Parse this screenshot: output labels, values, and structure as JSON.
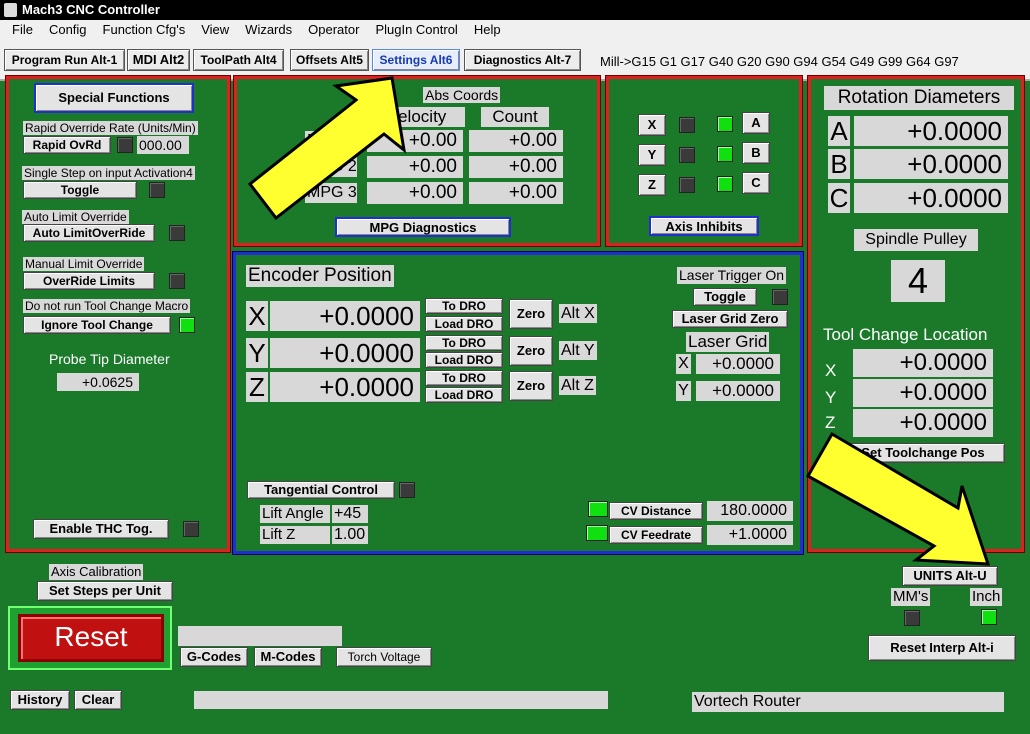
{
  "window": {
    "title": "Mach3 CNC Controller"
  },
  "menu": [
    "File",
    "Config",
    "Function Cfg's",
    "View",
    "Wizards",
    "Operator",
    "PlugIn Control",
    "Help"
  ],
  "tabs": [
    "Program Run Alt-1",
    "MDI Alt2",
    "ToolPath Alt4",
    "Offsets Alt5",
    "Settings Alt6",
    "Diagnostics Alt-7"
  ],
  "active_tab": "Settings Alt6",
  "modal_codes": "Mill->G15  G1 G17 G40 G20 G90 G94 G54 G49 G99 G64 G97",
  "special": {
    "title": "Special Functions",
    "rapid_label": "Rapid Override Rate (Units/Min)",
    "rapid_btn": "Rapid OvRd",
    "rapid_value": "000.00",
    "single_label": "Single Step on input Activation4",
    "toggle_btn": "Toggle",
    "auto_label": "Auto Limit Override",
    "auto_btn": "Auto LimitOverRide",
    "manual_label": "Manual Limit Override",
    "override_btn": "OverRide Limits",
    "toolchange_label": "Do not run Tool Change Macro",
    "ignore_btn": "Ignore Tool Change",
    "probe_label": "Probe Tip Diameter",
    "probe_value": "+0.0625",
    "thc_btn": "Enable THC Tog."
  },
  "mpg": {
    "abs_coords": "Abs Coords",
    "velocity": "Velocity",
    "count": "Count",
    "rows": [
      {
        "label": "MPG 1",
        "vel": "+0.00",
        "count": "+0.00"
      },
      {
        "label": "MPG 2",
        "vel": "+0.00",
        "count": "+0.00"
      },
      {
        "label": "MPG 3",
        "vel": "+0.00",
        "count": "+0.00"
      }
    ],
    "diag_btn": "MPG Diagnostics"
  },
  "inhibits": {
    "left": [
      "X",
      "Y",
      "Z"
    ],
    "right": [
      "A",
      "B",
      "C"
    ],
    "btn": "Axis Inhibits"
  },
  "encoder": {
    "title": "Encoder Position",
    "axes": [
      {
        "axis": "X",
        "value": "+0.0000",
        "alt": "Alt X"
      },
      {
        "axis": "Y",
        "value": "+0.0000",
        "alt": "Alt Y"
      },
      {
        "axis": "Z",
        "value": "+0.0000",
        "alt": "Alt Z"
      }
    ],
    "to_dro": "To DRO",
    "load_dro": "Load DRO",
    "zero": "Zero",
    "laser_trigger": "Laser Trigger On",
    "laser_toggle": "Toggle",
    "laser_zero": "Laser Grid Zero",
    "laser_grid": "Laser Grid",
    "laser_x": "+0.0000",
    "laser_y": "+0.0000",
    "tangential": "Tangential Control",
    "lift_angle_label": "Lift Angle",
    "lift_angle": "+45",
    "lift_z_label": "Lift Z",
    "lift_z": "1.00",
    "cv_distance_btn": "CV Distance",
    "cv_distance": "180.0000",
    "cv_feedrate_btn": "CV Feedrate",
    "cv_feedrate": "+1.0000"
  },
  "rotation": {
    "title": "Rotation Diameters",
    "rows": [
      {
        "axis": "A",
        "value": "+0.0000"
      },
      {
        "axis": "B",
        "value": "+0.0000"
      },
      {
        "axis": "C",
        "value": "+0.0000"
      }
    ],
    "pulley_label": "Spindle Pulley",
    "pulley_value": "4",
    "tcl_title": "Tool Change Location",
    "tcl_rows": [
      {
        "axis": "X",
        "value": "+0.0000"
      },
      {
        "axis": "Y",
        "value": "+0.0000"
      },
      {
        "axis": "Z",
        "value": "+0.0000"
      }
    ],
    "set_tc_btn": "Set Toolchange Pos"
  },
  "bottom": {
    "axis_cal": "Axis Calibration",
    "set_steps": "Set Steps per Unit",
    "reset": "Reset",
    "gcodes": "G-Codes",
    "mcodes": "M-Codes",
    "torch": "Torch Voltage",
    "history": "History",
    "clear": "Clear",
    "profile": "Vortech Router",
    "units_btn": "UNITS Alt-U",
    "mm": "MM's",
    "inch": "Inch",
    "reset_interp": "Reset Interp Alt-i"
  },
  "colors": {
    "panel_green": "#1a7a2a",
    "frame_red": "#e02020",
    "frame_blue": "#2030d0",
    "led_on": "#10e010",
    "arrow": "#ffff30"
  }
}
